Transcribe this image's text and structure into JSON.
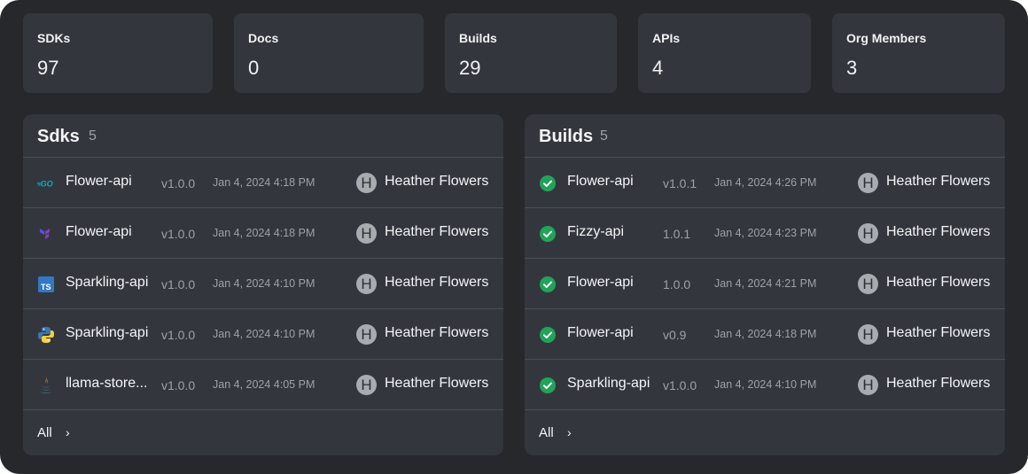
{
  "stats": [
    {
      "label": "SDKs",
      "value": "97"
    },
    {
      "label": "Docs",
      "value": "0"
    },
    {
      "label": "Builds",
      "value": "29"
    },
    {
      "label": "APIs",
      "value": "4"
    },
    {
      "label": "Org Members",
      "value": "3"
    }
  ],
  "sdks": {
    "title": "Sdks",
    "count": "5",
    "footer_label": "All",
    "rows": [
      {
        "icon": "go-icon",
        "name": "Flower-api",
        "version": "v1.0.0",
        "date": "Jan 4, 2024 4:18 PM",
        "avatar": "H",
        "user": "Heather Flowers"
      },
      {
        "icon": "terraform-icon",
        "name": "Flower-api",
        "version": "v1.0.0",
        "date": "Jan 4, 2024 4:18 PM",
        "avatar": "H",
        "user": "Heather Flowers"
      },
      {
        "icon": "typescript-icon",
        "name": "Sparkling-api",
        "version": "v1.0.0",
        "date": "Jan 4, 2024 4:10 PM",
        "avatar": "H",
        "user": "Heather Flowers"
      },
      {
        "icon": "python-icon",
        "name": "Sparkling-api",
        "version": "v1.0.0",
        "date": "Jan 4, 2024 4:10 PM",
        "avatar": "H",
        "user": "Heather Flowers"
      },
      {
        "icon": "java-icon",
        "name": "llama-store...",
        "version": "v1.0.0",
        "date": "Jan 4, 2024 4:05 PM",
        "avatar": "H",
        "user": "Heather Flowers"
      }
    ]
  },
  "builds": {
    "title": "Builds",
    "count": "5",
    "footer_label": "All",
    "rows": [
      {
        "icon": "success-check-icon",
        "name": "Flower-api",
        "version": "v1.0.1",
        "date": "Jan 4, 2024 4:26 PM",
        "avatar": "H",
        "user": "Heather Flowers"
      },
      {
        "icon": "success-check-icon",
        "name": "Fizzy-api",
        "version": "1.0.1",
        "date": "Jan 4, 2024 4:23 PM",
        "avatar": "H",
        "user": "Heather Flowers"
      },
      {
        "icon": "success-check-icon",
        "name": "Flower-api",
        "version": "1.0.0",
        "date": "Jan 4, 2024 4:21 PM",
        "avatar": "H",
        "user": "Heather Flowers"
      },
      {
        "icon": "success-check-icon",
        "name": "Flower-api",
        "version": "v0.9",
        "date": "Jan 4, 2024 4:18 PM",
        "avatar": "H",
        "user": "Heather Flowers"
      },
      {
        "icon": "success-check-icon",
        "name": "Sparkling-api",
        "version": "v1.0.0",
        "date": "Jan 4, 2024 4:10 PM",
        "avatar": "H",
        "user": "Heather Flowers"
      }
    ]
  },
  "colors": {
    "success": "#22a35a",
    "typescript": "#3178c6",
    "go": "#00add8",
    "terraform": "#7b42bc"
  }
}
